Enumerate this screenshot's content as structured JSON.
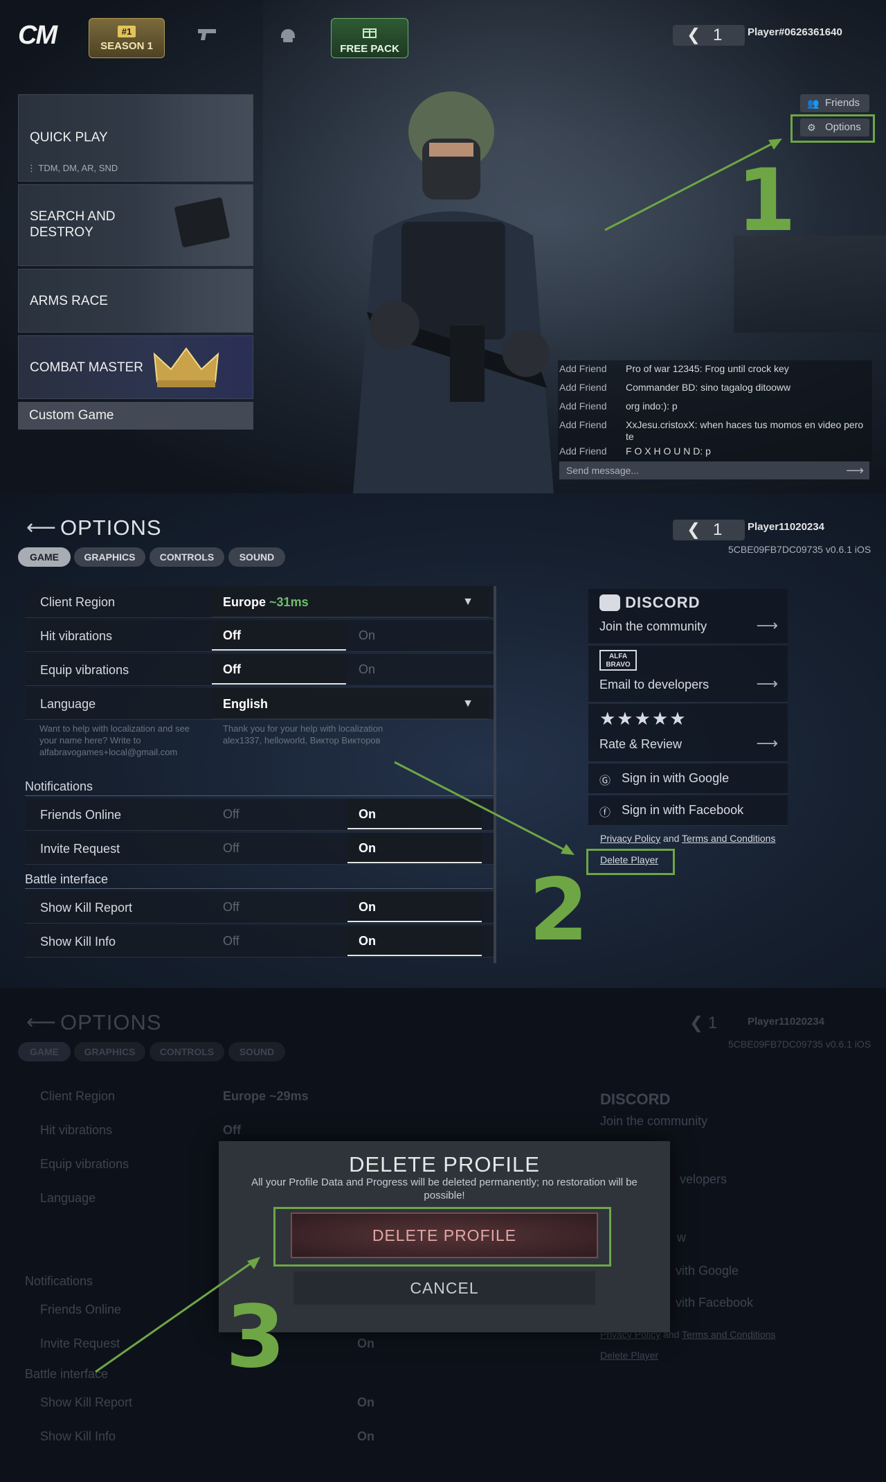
{
  "panel1": {
    "logo": "CM",
    "season": {
      "badge": "#1",
      "label": "SEASON 1"
    },
    "nav_icons": [
      "pistol-icon",
      "helmet-icon"
    ],
    "free_pack": "FREE PACK",
    "level": "1",
    "player": "Player#0626361640",
    "modes": [
      {
        "title": "QUICK PLAY",
        "sub": "TDM, DM, AR, SND"
      },
      {
        "title": "SEARCH AND DESTROY"
      },
      {
        "title": "ARMS RACE"
      },
      {
        "title": "COMBAT MASTER"
      }
    ],
    "custom": "Custom Game",
    "friends_btn": "Friends",
    "options_btn": "Options",
    "step": "1",
    "chat": [
      {
        "action": "Add Friend",
        "msg": "Pro of war 12345: Frog until crock key"
      },
      {
        "action": "Add Friend",
        "msg": "Commander BD: sino tagalog ditooww"
      },
      {
        "action": "Add Friend",
        "msg": "org indo:): p"
      },
      {
        "action": "Add Friend",
        "msg": "XxJesu.cristoxX: when haces tus momos en video pero te"
      },
      {
        "action": "Add Friend",
        "msg": "F O X H O U N D: p"
      }
    ],
    "chat_placeholder": "Send message..."
  },
  "panel2": {
    "title": "OPTIONS",
    "tabs": [
      "GAME",
      "GRAPHICS",
      "CONTROLS",
      "SOUND"
    ],
    "level": "1",
    "player": "Player11020234",
    "build": "5CBE09FB7DC09735 v0.6.1 iOS",
    "client_region": {
      "label": "Client Region",
      "value": "Europe",
      "ping": "~31ms"
    },
    "hit_vibrations": {
      "label": "Hit vibrations",
      "off": "Off",
      "on": "On"
    },
    "equip_vibrations": {
      "label": "Equip vibrations",
      "off": "Off",
      "on": "On"
    },
    "language": {
      "label": "Language",
      "value": "English"
    },
    "loc_note_left": "Want to help with localization and see your name here? Write to alfabravogames+local@gmail.com",
    "loc_note_right": "Thank you for your help with localization alex1337, helloworld, Виктор Викторов",
    "notifications": "Notifications",
    "friends_online": {
      "label": "Friends Online",
      "off": "Off",
      "on": "On"
    },
    "invite_request": {
      "label": "Invite Request",
      "off": "Off",
      "on": "On"
    },
    "battle_interface": "Battle interface",
    "show_kill_report": {
      "label": "Show Kill Report",
      "off": "Off",
      "on": "On"
    },
    "show_kill_info": {
      "label": "Show Kill Info",
      "off": "Off",
      "on": "On"
    },
    "discord": {
      "brand": "DISCORD",
      "text": "Join the community"
    },
    "alfa": {
      "brand": "ALFA BRAVO",
      "text": "Email to developers"
    },
    "rate": {
      "stars": "★★★★★",
      "text": "Rate & Review"
    },
    "google": "Sign in with Google",
    "facebook": "Sign in with Facebook",
    "privacy": "Privacy Policy",
    "and": "and",
    "terms": "Terms and Conditions",
    "delete_player": "Delete Player",
    "step": "2"
  },
  "panel3": {
    "title": "OPTIONS",
    "tabs": [
      "GAME",
      "GRAPHICS",
      "CONTROLS",
      "SOUND"
    ],
    "level": "1",
    "player": "Player11020234",
    "build": "5CBE09FB7DC09735 v0.6.1 iOS",
    "client_region": {
      "label": "Client Region",
      "value": "Europe",
      "ping": "~29ms"
    },
    "rows": [
      "Hit vibrations",
      "Equip vibrations",
      "Language"
    ],
    "notifications": "Notifications",
    "rows2": [
      "Friends Online",
      "Invite Request"
    ],
    "battle_interface": "Battle interface",
    "rows3": [
      "Show Kill Report",
      "Show Kill Info"
    ],
    "off": "Off",
    "on": "On",
    "dialog": {
      "title": "DELETE PROFILE",
      "text": "All your Profile Data and Progress will be deleted permanently; no restoration will be possible!",
      "delete": "DELETE PROFILE",
      "cancel": "CANCEL"
    },
    "side": {
      "discord": "DISCORD",
      "join": "Join the community",
      "email_tail": "velopers",
      "rate_tail": "w",
      "google_tail": "vith Google",
      "facebook_tail": "vith Facebook"
    },
    "privacy": "Privacy Policy",
    "and": "and",
    "terms": "Terms and Conditions",
    "delete_player": "Delete Player",
    "step": "3"
  },
  "colors": {
    "annotation_green": "#6ea645",
    "active_tab": "#a8adb4",
    "ping_green": "#6fbf6a",
    "delete_red": "#e3a6a3"
  }
}
